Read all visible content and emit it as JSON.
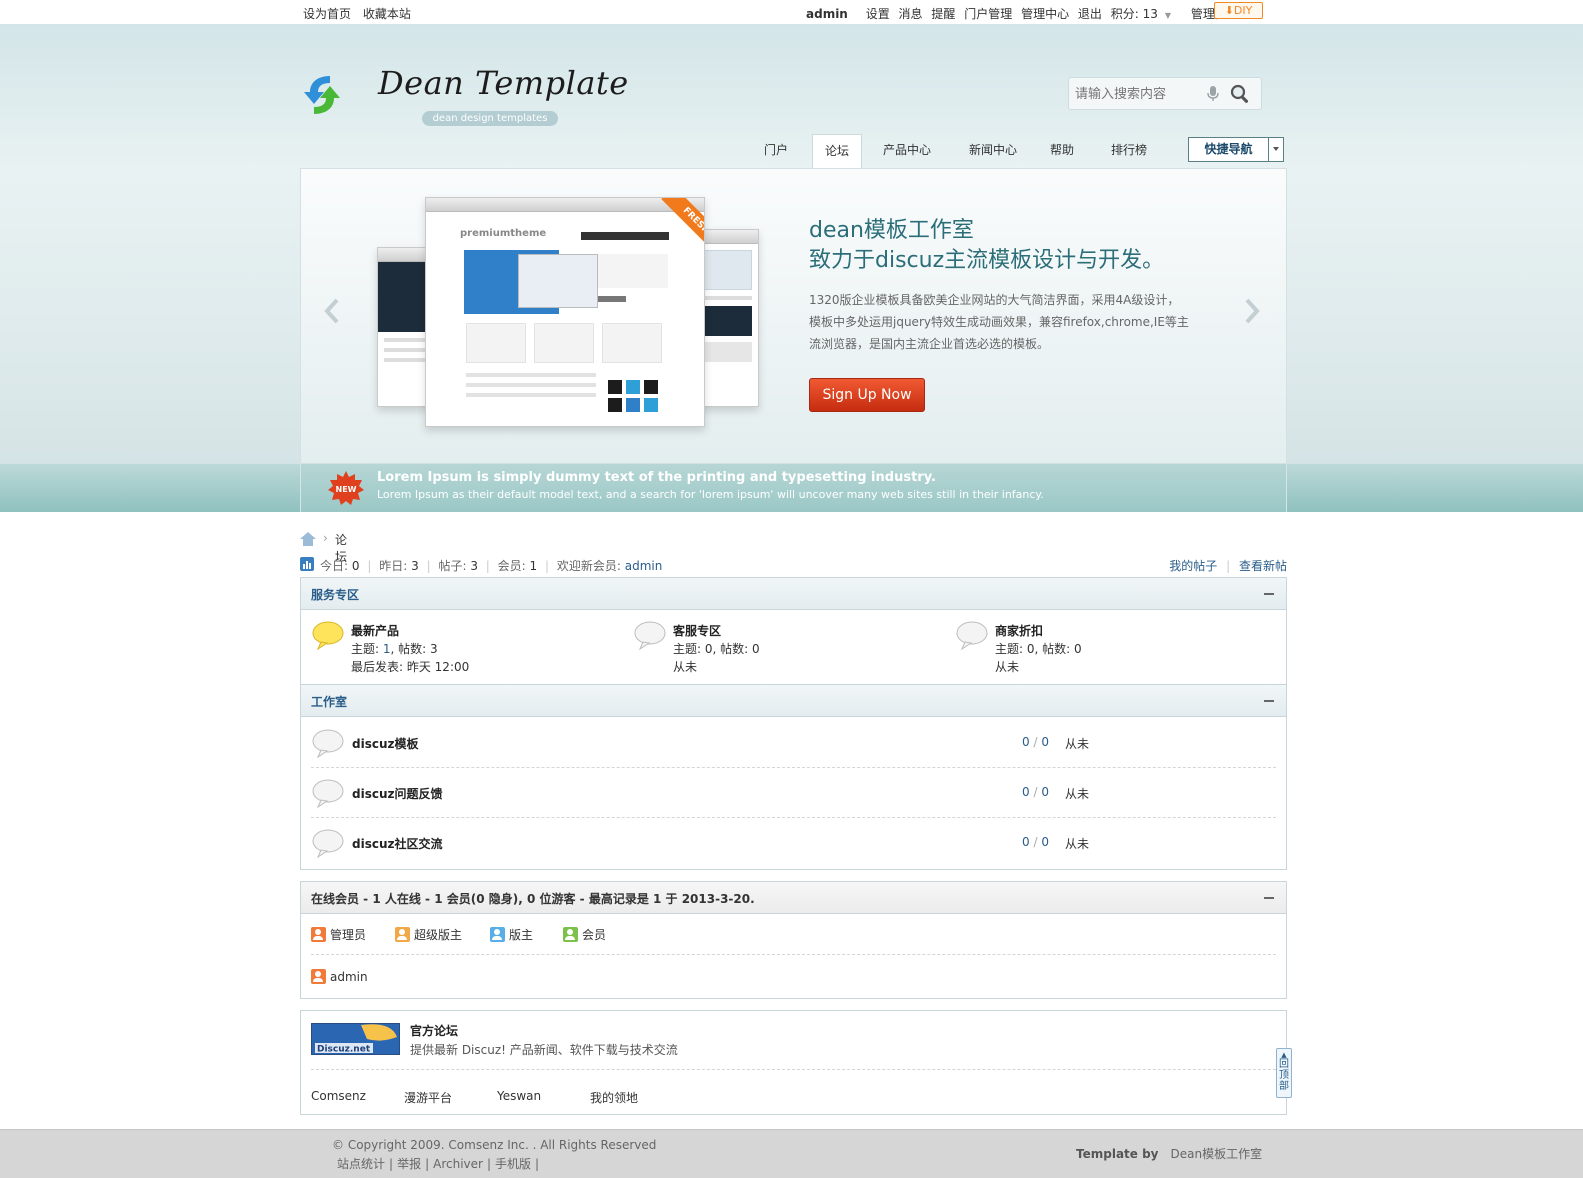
{
  "topbar": {
    "left_links": [
      "设为首页",
      "收藏本站"
    ],
    "username": "admin",
    "right_links": [
      "设置",
      "消息",
      "提醒",
      "门户管理",
      "管理中心",
      "退出"
    ],
    "points": "积分: 13",
    "role": "管理员",
    "diy": "DIY"
  },
  "header": {
    "logo_text": "Dean Template",
    "logo_sub": "dean design templates",
    "search_placeholder": "请输入搜索内容"
  },
  "nav": {
    "items": [
      "门户",
      "论坛",
      "产品中心",
      "新闻中心",
      "帮助",
      "排行榜"
    ],
    "active_index": 1,
    "quick_nav": "快捷导航"
  },
  "banner": {
    "title_line1": "dean模板工作室",
    "title_line2": "致力于discuz主流模板设计与开发。",
    "desc": "1320版企业模板具备欧美企业网站的大气简洁界面，采用4A级设计，模板中多处运用jquery特效生成动画效果，兼容firefox,chrome,IE等主流浏览器，是国内主流企业首选必选的模板。",
    "signup": "Sign Up Now",
    "mock_brand": "premiumtheme",
    "mock_ribbon": "FRESH"
  },
  "strip": {
    "badge": "NEW",
    "title": "Lorem Ipsum is simply dummy text of the printing and typesetting industry.",
    "subtitle": "Lorem Ipsum as their default model text, and a search for 'lorem ipsum' will uncover many web sites still in their infancy."
  },
  "breadcrumb": {
    "separator": "›",
    "current": "论坛"
  },
  "stats": {
    "today_label": "今日:",
    "today": "0",
    "yesterday_label": "昨日:",
    "yesterday": "3",
    "posts_label": "帖子:",
    "posts": "3",
    "members_label": "会员:",
    "members": "1",
    "newest_label": "欢迎新会员:",
    "newest": "admin",
    "my_posts": "我的帖子",
    "new_posts": "查看新帖"
  },
  "service": {
    "title": "服务专区",
    "forums": [
      {
        "name": "最新产品",
        "stats_label": "主题: ",
        "threads": "1",
        "posts_label": ", 帖数: ",
        "posts": "3",
        "last_label": "最后发表: ",
        "last": "昨天 12:00"
      },
      {
        "name": "客服专区",
        "stats_label": "主题: ",
        "threads": "0",
        "posts_label": ", 帖数: ",
        "posts": "0",
        "last": "从未"
      },
      {
        "name": "商家折扣",
        "stats_label": "主题: ",
        "threads": "0",
        "posts_label": ", 帖数: ",
        "posts": "0",
        "last": "从未"
      }
    ]
  },
  "studio": {
    "title": "工作室",
    "forums": [
      {
        "name": "discuz模板",
        "threads": "0",
        "posts": "0",
        "last": "从未"
      },
      {
        "name": "discuz问题反馈",
        "threads": "0",
        "posts": "0",
        "last": "从未"
      },
      {
        "name": "discuz社区交流",
        "threads": "0",
        "posts": "0",
        "last": "从未"
      }
    ]
  },
  "online": {
    "title": "在线会员 - 1 人在线 - 1 会员(0 隐身), 0 位游客 - 最高记录是 1 于 2013-3-20.",
    "legend": [
      "管理员",
      "超级版主",
      "版主",
      "会员"
    ],
    "users": [
      "admin"
    ]
  },
  "links": {
    "logo_text": "Discuz.net",
    "title": "官方论坛",
    "desc": "提供最新 Discuz! 产品新闻、软件下载与技术交流",
    "text_links": [
      "Comsenz",
      "漫游平台",
      "Yeswan",
      "我的领地"
    ]
  },
  "back_top": "回顶部",
  "footer": {
    "copyright": "© Copyright 2009.  Comsenz Inc.  . All Rights Reserved",
    "links": [
      "站点统计",
      "举报",
      "Archiver",
      "手机版"
    ],
    "template_by": "Template by",
    "studio": "Dean模板工作室"
  },
  "colors": {
    "accent_blue": "#2a5d8a",
    "signup_red": "#d9401e",
    "diy_orange": "#f08a24",
    "header_bg": "#dbe9eb",
    "strip_teal": "#9ac8c6"
  }
}
